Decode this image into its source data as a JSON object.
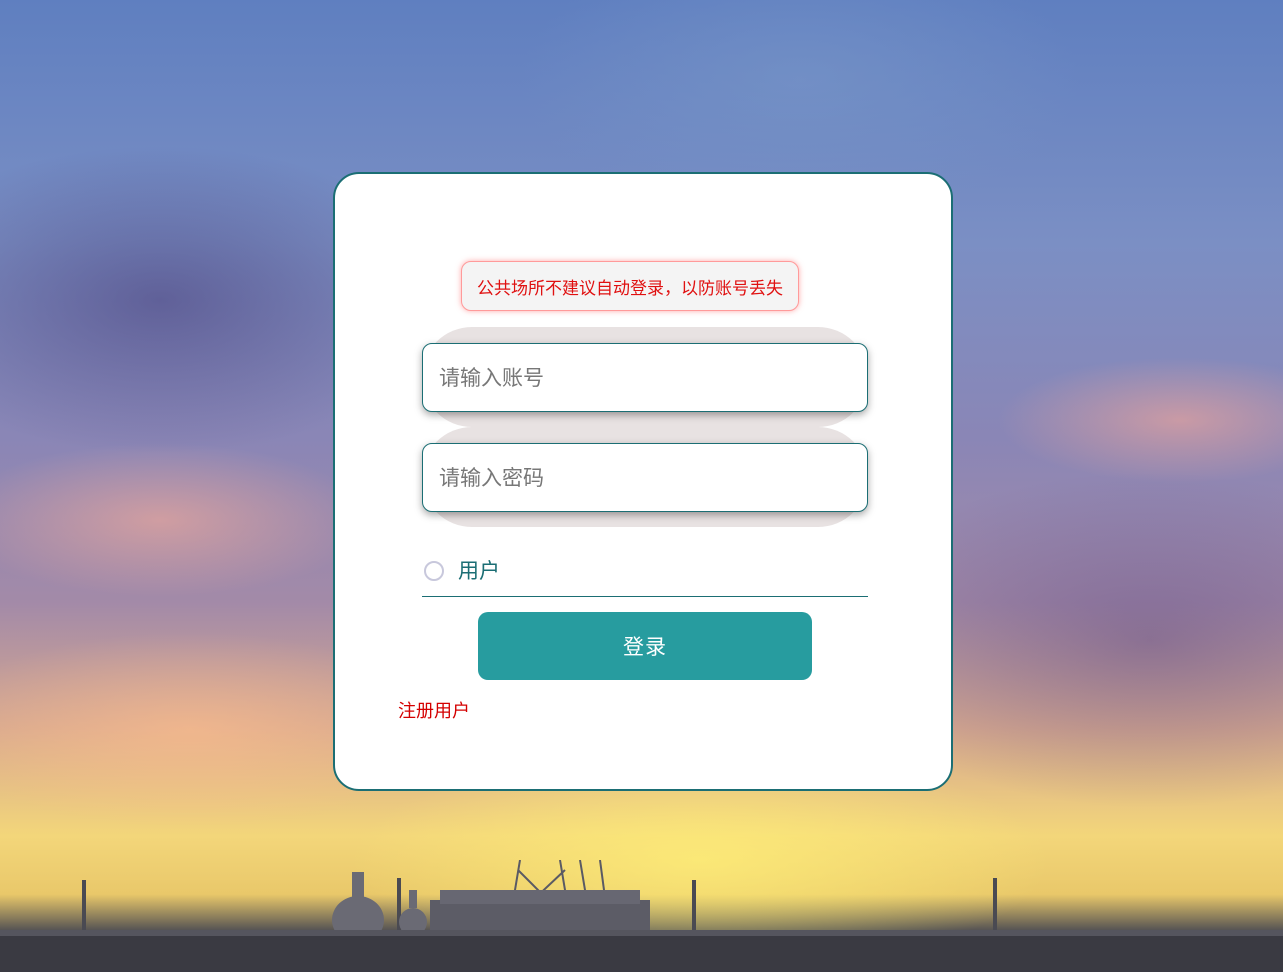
{
  "login_form": {
    "notice": "公共场所不建议自动登录，以防账号丢失",
    "account_placeholder": "请输入账号",
    "password_placeholder": "请输入密码",
    "role_option_label": "用户",
    "login_button_label": "登录",
    "register_link_label": "注册用户"
  },
  "colors": {
    "card_border": "#1b6e74",
    "login_button": "#279c9f",
    "notice_text": "#e01010",
    "register_link": "#d40000"
  }
}
